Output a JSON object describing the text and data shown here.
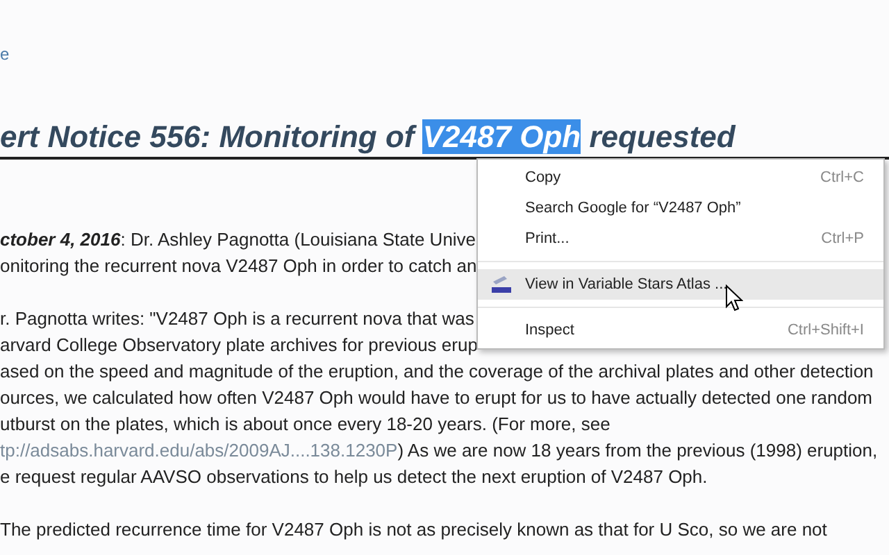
{
  "top_link": "e",
  "title": {
    "before": "ert Notice 556: Monitoring of ",
    "selected_text": "V2487 Oph",
    "after": " requested"
  },
  "paragraphs": [
    {
      "lines": [
        {
          "date": "ctober 4, 2016",
          "text": ": Dr. Ashley Pagnotta (Louisiana State Unive"
        },
        {
          "text": "onitoring the recurrent nova V2487 Oph in order to catch an"
        }
      ]
    },
    {
      "lines": [
        {
          "text": "r. Pagnotta writes: \"V2487 Oph is a recurrent nova that was"
        },
        {
          "text": "arvard College Observatory plate archives for previous erup"
        },
        {
          "text": "ased on the speed and magnitude of the eruption, and the coverage of the archival plates and other detection"
        },
        {
          "text": "ources, we calculated how often V2487 Oph would have to erupt for us to have actually detected one random"
        },
        {
          "text": "utburst on the plates, which is about once every 18-20 years. (For more, see"
        },
        {
          "link": "tp://adsabs.harvard.edu/abs/2009AJ....138.1230P",
          "text": ") As we are now 18 years from the previous (1998) eruption,"
        },
        {
          "text": "e request regular AAVSO observations to help us detect the next eruption of V2487 Oph."
        }
      ]
    },
    {
      "lines": [
        {
          "text": "The predicted recurrence time for V2487 Oph is not as precisely known as that for U Sco, so we are not"
        }
      ]
    }
  ],
  "context_menu": [
    {
      "kind": "item",
      "label": "Copy",
      "shortcut": "Ctrl+C",
      "selected": false
    },
    {
      "kind": "item",
      "label": "Search Google for “V2487 Oph”",
      "selected": false
    },
    {
      "kind": "item",
      "label": "Print...",
      "shortcut": "Ctrl+P",
      "selected": false
    },
    {
      "kind": "separator"
    },
    {
      "kind": "extension",
      "label": "View in Variable Stars Atlas ...",
      "selected": true
    },
    {
      "kind": "separator"
    },
    {
      "kind": "item",
      "label": "Inspect",
      "shortcut": "Ctrl+Shift+I",
      "selected": false
    }
  ]
}
